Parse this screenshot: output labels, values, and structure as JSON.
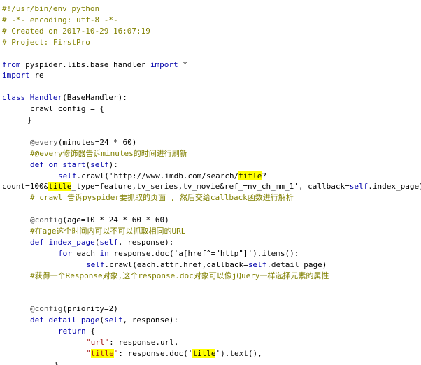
{
  "editor": {
    "lines": [
      {
        "indent": 0,
        "tokens": [
          {
            "t": "#!/usr/bin/env python",
            "c": "comment"
          }
        ]
      },
      {
        "indent": 0,
        "tokens": [
          {
            "t": "# -*- encoding: utf-8 -*-",
            "c": "comment"
          }
        ]
      },
      {
        "indent": 0,
        "tokens": [
          {
            "t": "# Created on 2017-10-29 16:07:19",
            "c": "comment"
          }
        ]
      },
      {
        "indent": 0,
        "tokens": [
          {
            "t": "# Project: FirstPro",
            "c": "comment"
          }
        ]
      },
      {
        "indent": 0,
        "tokens": []
      },
      {
        "indent": 0,
        "tokens": [
          {
            "t": "from",
            "c": "keyword"
          },
          {
            "t": " pyspider.libs.base_handler ",
            "c": "plain"
          },
          {
            "t": "import",
            "c": "keyword"
          },
          {
            "t": " *",
            "c": "plain"
          }
        ]
      },
      {
        "indent": 0,
        "tokens": [
          {
            "t": "import",
            "c": "keyword"
          },
          {
            "t": " re",
            "c": "plain"
          }
        ]
      },
      {
        "indent": 0,
        "tokens": []
      },
      {
        "indent": 0,
        "tokens": [
          {
            "t": "class",
            "c": "keyword"
          },
          {
            "t": " ",
            "c": "plain"
          },
          {
            "t": "Handler",
            "c": "classname"
          },
          {
            "t": "(BaseHandler):",
            "c": "plain"
          }
        ]
      },
      {
        "indent": 40,
        "tokens": [
          {
            "t": "crawl_config = {",
            "c": "plain"
          }
        ]
      },
      {
        "indent": 36,
        "tokens": [
          {
            "t": "}",
            "c": "plain"
          }
        ]
      },
      {
        "indent": 0,
        "tokens": []
      },
      {
        "indent": 40,
        "tokens": [
          {
            "t": "@every",
            "c": "decorator"
          },
          {
            "t": "(minutes=",
            "c": "plain"
          },
          {
            "t": "24",
            "c": "number"
          },
          {
            "t": " * ",
            "c": "plain"
          },
          {
            "t": "60",
            "c": "number"
          },
          {
            "t": ")",
            "c": "plain"
          }
        ]
      },
      {
        "indent": 40,
        "tokens": [
          {
            "t": "#@every修饰器告诉minutes的时间进行刷新",
            "c": "comment"
          }
        ]
      },
      {
        "indent": 40,
        "tokens": [
          {
            "t": "def",
            "c": "keyword"
          },
          {
            "t": " ",
            "c": "plain"
          },
          {
            "t": "on_start",
            "c": "classname"
          },
          {
            "t": "(",
            "c": "plain"
          },
          {
            "t": "self",
            "c": "selfkw"
          },
          {
            "t": "):",
            "c": "plain"
          }
        ]
      },
      {
        "indent": 80,
        "tokens": [
          {
            "t": "self",
            "c": "selfkw"
          },
          {
            "t": ".crawl('http://www.imdb.com/search/",
            "c": "plain"
          },
          {
            "t": "title",
            "c": "hl"
          },
          {
            "t": "?",
            "c": "plain"
          }
        ]
      },
      {
        "indent": 0,
        "tokens": [
          {
            "t": "count=100&",
            "c": "plain"
          },
          {
            "t": "title",
            "c": "hl"
          },
          {
            "t": "_type=feature,tv_series,tv_movie&ref_=nv_ch_mm_1', callback=",
            "c": "plain"
          },
          {
            "t": "self",
            "c": "selfkw"
          },
          {
            "t": ".index_page)",
            "c": "plain"
          }
        ]
      },
      {
        "indent": 40,
        "tokens": [
          {
            "t": "# crawl 告诉pyspider要抓取的页面 , 然后交给callback函数进行解析",
            "c": "comment"
          }
        ]
      },
      {
        "indent": 0,
        "tokens": []
      },
      {
        "indent": 40,
        "tokens": [
          {
            "t": "@config",
            "c": "decorator"
          },
          {
            "t": "(age=",
            "c": "plain"
          },
          {
            "t": "10",
            "c": "number"
          },
          {
            "t": " * ",
            "c": "plain"
          },
          {
            "t": "24",
            "c": "number"
          },
          {
            "t": " * ",
            "c": "plain"
          },
          {
            "t": "60",
            "c": "number"
          },
          {
            "t": " * ",
            "c": "plain"
          },
          {
            "t": "60",
            "c": "number"
          },
          {
            "t": ")",
            "c": "plain"
          }
        ]
      },
      {
        "indent": 40,
        "tokens": [
          {
            "t": "#在age这个时间内可以不可以抓取相同的URL",
            "c": "comment"
          }
        ]
      },
      {
        "indent": 40,
        "tokens": [
          {
            "t": "def",
            "c": "keyword"
          },
          {
            "t": " ",
            "c": "plain"
          },
          {
            "t": "index_page",
            "c": "classname"
          },
          {
            "t": "(",
            "c": "plain"
          },
          {
            "t": "self",
            "c": "selfkw"
          },
          {
            "t": ", response):",
            "c": "plain"
          }
        ]
      },
      {
        "indent": 80,
        "tokens": [
          {
            "t": "for",
            "c": "keyword"
          },
          {
            "t": " each ",
            "c": "plain"
          },
          {
            "t": "in",
            "c": "keyword"
          },
          {
            "t": " response.doc('a[href^=\"http\"]').items():",
            "c": "plain"
          }
        ]
      },
      {
        "indent": 120,
        "tokens": [
          {
            "t": "self",
            "c": "selfkw"
          },
          {
            "t": ".crawl(each.attr.href,callback=",
            "c": "plain"
          },
          {
            "t": "self",
            "c": "selfkw"
          },
          {
            "t": ".detail_page)",
            "c": "plain"
          }
        ]
      },
      {
        "indent": 40,
        "tokens": [
          {
            "t": "#获得一个Response对象,这个response.doc对象可以像jQuery一样选择元素的属性",
            "c": "comment"
          }
        ]
      },
      {
        "indent": 0,
        "tokens": []
      },
      {
        "indent": 0,
        "tokens": []
      },
      {
        "indent": 40,
        "tokens": [
          {
            "t": "@config",
            "c": "decorator"
          },
          {
            "t": "(priority=",
            "c": "plain"
          },
          {
            "t": "2",
            "c": "number"
          },
          {
            "t": ")",
            "c": "plain"
          }
        ]
      },
      {
        "indent": 40,
        "tokens": [
          {
            "t": "def",
            "c": "keyword"
          },
          {
            "t": " ",
            "c": "plain"
          },
          {
            "t": "detail_page",
            "c": "classname"
          },
          {
            "t": "(",
            "c": "plain"
          },
          {
            "t": "self",
            "c": "selfkw"
          },
          {
            "t": ", response):",
            "c": "plain"
          }
        ]
      },
      {
        "indent": 80,
        "tokens": [
          {
            "t": "return",
            "c": "keyword"
          },
          {
            "t": " {",
            "c": "plain"
          }
        ]
      },
      {
        "indent": 120,
        "tokens": [
          {
            "t": "\"url\"",
            "c": "strred"
          },
          {
            "t": ": response.url,",
            "c": "plain"
          }
        ]
      },
      {
        "indent": 120,
        "tokens": [
          {
            "t": "\"",
            "c": "strred"
          },
          {
            "t": "title",
            "c": "hlstr"
          },
          {
            "t": "\"",
            "c": "strred"
          },
          {
            "t": ": response.doc('",
            "c": "plain"
          },
          {
            "t": "title",
            "c": "hl"
          },
          {
            "t": "').text(),",
            "c": "plain"
          }
        ]
      },
      {
        "indent": 74,
        "tokens": [
          {
            "t": "}",
            "c": "plain"
          }
        ]
      }
    ]
  }
}
